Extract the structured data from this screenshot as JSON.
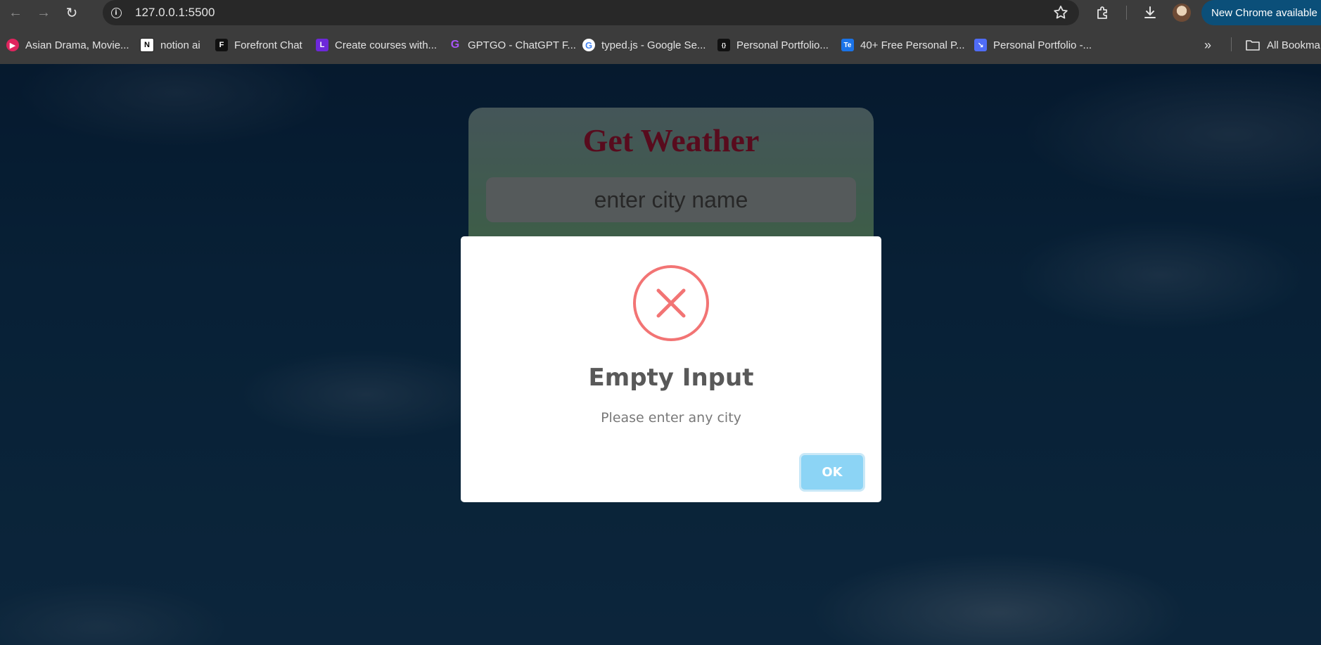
{
  "browser": {
    "url": "127.0.0.1:5500",
    "update_label": "New Chrome available",
    "bookmarks": [
      {
        "label": "Asian Drama, Movie...",
        "icon": "play-circle-icon",
        "color": "#e0245e"
      },
      {
        "label": "notion ai",
        "icon": "notion-icon",
        "color": "#ffffff"
      },
      {
        "label": "Forefront Chat",
        "icon": "forefront-icon",
        "color": "#111111"
      },
      {
        "label": "Create courses with...",
        "icon": "letter-l-icon",
        "color": "#6d28d9"
      },
      {
        "label": "GPTGO - ChatGPT F...",
        "icon": "gptgo-icon",
        "color": "#a855f7"
      },
      {
        "label": "typed.js - Google Se...",
        "icon": "google-icon",
        "color": "#ffffff"
      },
      {
        "label": "Personal Portfolio...",
        "icon": "code-icon",
        "color": "#111111"
      },
      {
        "label": "40+ Free Personal P...",
        "icon": "te-icon",
        "color": "#1a73e8"
      },
      {
        "label": "Personal Portfolio -...",
        "icon": "pen-square-icon",
        "color": "#4f6cf7"
      }
    ],
    "all_bookmarks_label": "All Bookma"
  },
  "app": {
    "title": "Get Weather",
    "city_placeholder": "enter city name",
    "city_value": ""
  },
  "alert": {
    "icon": "error-x-icon",
    "title": "Empty Input",
    "text": "Please enter any city",
    "ok_label": "OK",
    "error_color": "#f27474",
    "ok_color": "#8cd4f5"
  }
}
